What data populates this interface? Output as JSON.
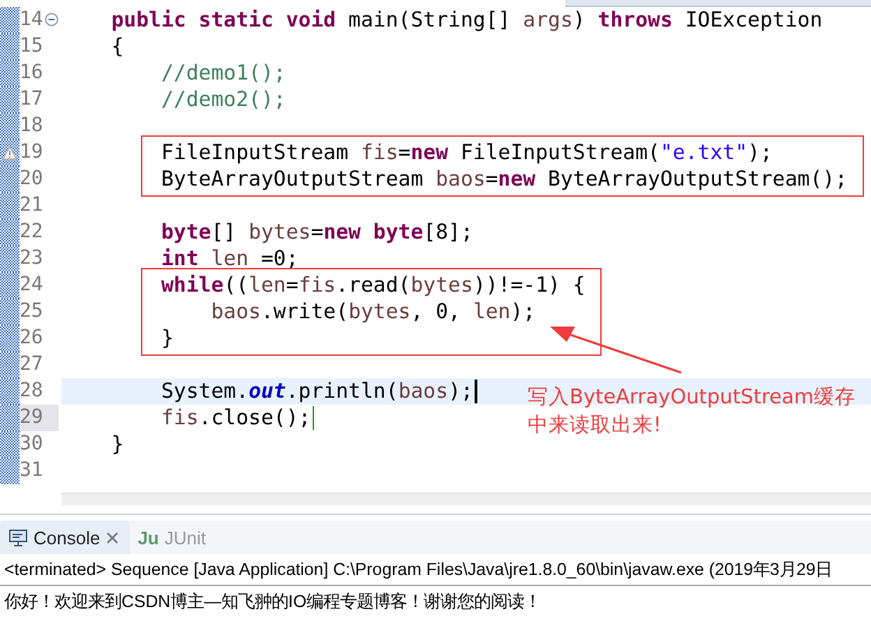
{
  "editor": {
    "blocks": [
      {
        "boxed": false,
        "lines": [
          {
            "number": "14",
            "current": false,
            "kind": "fold",
            "tokens": [
              {
                "kind": "kw",
                "text": "    public static void"
              },
              {
                "kind": "plain",
                "text": " main(String[] "
              },
              {
                "kind": "var",
                "text": "args"
              },
              {
                "kind": "plain",
                "text": ") "
              },
              {
                "kind": "kw",
                "text": "throws"
              },
              {
                "kind": "plain",
                "text": " IOException"
              }
            ]
          },
          {
            "number": "15",
            "current": false,
            "kind": "plain",
            "tokens": [
              {
                "kind": "plain",
                "text": "    {"
              }
            ]
          },
          {
            "number": "16",
            "current": false,
            "kind": "plain",
            "tokens": [
              {
                "kind": "comment",
                "text": "        //demo1();"
              }
            ]
          },
          {
            "number": "17",
            "current": false,
            "kind": "plain",
            "tokens": [
              {
                "kind": "comment",
                "text": "        //demo2();"
              }
            ]
          },
          {
            "number": "18",
            "current": false,
            "kind": "plain"
          }
        ]
      },
      {
        "boxed": true,
        "lines": [
          {
            "number": "19",
            "current": false,
            "kind": "warning",
            "tokens": [
              {
                "kind": "plain",
                "text": "        FileInputStream "
              },
              {
                "kind": "var",
                "text": "fis"
              },
              {
                "kind": "plain",
                "text": "="
              },
              {
                "kind": "kw",
                "text": "new"
              },
              {
                "kind": "plain",
                "text": " FileInputStream("
              },
              {
                "kind": "string",
                "text": "\"e.txt\""
              },
              {
                "kind": "plain",
                "text": ");"
              }
            ]
          },
          {
            "number": "20",
            "current": false,
            "kind": "plain",
            "tokens": [
              {
                "kind": "plain",
                "text": "        ByteArrayOutputStream "
              },
              {
                "kind": "var",
                "text": "baos"
              },
              {
                "kind": "plain",
                "text": "="
              },
              {
                "kind": "kw",
                "text": "new"
              },
              {
                "kind": "plain",
                "text": " ByteArrayOutputStream();"
              }
            ]
          }
        ]
      },
      {
        "boxed": false,
        "lines": [
          {
            "number": "21",
            "current": false,
            "kind": "plain"
          },
          {
            "number": "22",
            "current": false,
            "kind": "plain",
            "tokens": [
              {
                "kind": "kw",
                "text": "        byte"
              },
              {
                "kind": "plain",
                "text": "[] "
              },
              {
                "kind": "var",
                "text": "bytes"
              },
              {
                "kind": "plain",
                "text": "="
              },
              {
                "kind": "kw",
                "text": "new byte"
              },
              {
                "kind": "plain",
                "text": "[8];"
              }
            ]
          },
          {
            "number": "23",
            "current": false,
            "kind": "plain",
            "tokens": [
              {
                "kind": "kw",
                "text": "        int"
              },
              {
                "kind": "var",
                "text": " len"
              },
              {
                "kind": "plain",
                "text": " =0;"
              }
            ]
          }
        ]
      },
      {
        "boxed": true,
        "lines": [
          {
            "number": "24",
            "current": false,
            "kind": "plain",
            "tokens": [
              {
                "kind": "kw",
                "text": "        while"
              },
              {
                "kind": "plain",
                "text": "(("
              },
              {
                "kind": "var",
                "text": "len"
              },
              {
                "kind": "plain",
                "text": "="
              },
              {
                "kind": "var",
                "text": "fis"
              },
              {
                "kind": "plain",
                "text": ".read("
              },
              {
                "kind": "var",
                "text": "bytes"
              },
              {
                "kind": "plain",
                "text": "))!=-1) {"
              }
            ]
          },
          {
            "number": "25",
            "current": false,
            "kind": "plain",
            "tokens": [
              {
                "kind": "var",
                "text": "            baos"
              },
              {
                "kind": "plain",
                "text": ".write("
              },
              {
                "kind": "var",
                "text": "bytes"
              },
              {
                "kind": "plain",
                "text": ", 0, "
              },
              {
                "kind": "var",
                "text": "len"
              },
              {
                "kind": "plain",
                "text": ");"
              }
            ]
          },
          {
            "number": "26",
            "current": false,
            "kind": "plain",
            "tokens": [
              {
                "kind": "plain",
                "text": "        }"
              }
            ]
          }
        ]
      },
      {
        "boxed": false,
        "lines": [
          {
            "number": "27",
            "current": false,
            "kind": "plain"
          },
          {
            "number": "28",
            "current": true,
            "kind": "plain",
            "tokens": [
              {
                "kind": "plain",
                "text": "        System."
              },
              {
                "kind": "field",
                "text": "out"
              },
              {
                "kind": "plain",
                "text": ".println("
              },
              {
                "kind": "var",
                "text": "baos"
              },
              {
                "kind": "plain",
                "text": ");"
              }
            ]
          },
          {
            "number": "29",
            "current": false,
            "kind": "plain",
            "cursor": true,
            "tokens": [
              {
                "kind": "var",
                "text": "        fis"
              },
              {
                "kind": "plain",
                "text": ".close();"
              }
            ]
          },
          {
            "number": "30",
            "current": false,
            "kind": "plain",
            "tokens": [
              {
                "kind": "plain",
                "text": "    }"
              }
            ]
          },
          {
            "number": "31",
            "current": false,
            "kind": "plain"
          }
        ]
      }
    ]
  },
  "annotation": {
    "text": "写入ByteArrayOutputStream缓存中来读取出来!"
  },
  "console": {
    "tabs": [
      {
        "label": "Console",
        "selected": true,
        "closable": true
      },
      {
        "label": "JUnit",
        "selected": false,
        "closable": false,
        "icon_text": "Ju"
      }
    ],
    "header": "<terminated> Sequence [Java Application] C:\\Program Files\\Java\\jre1.8.0_60\\bin\\javaw.exe (2019年3月29日",
    "output": "你好！欢迎来到CSDN博主—知飞翀的IO编程专题博客！谢谢您的阅读！"
  }
}
